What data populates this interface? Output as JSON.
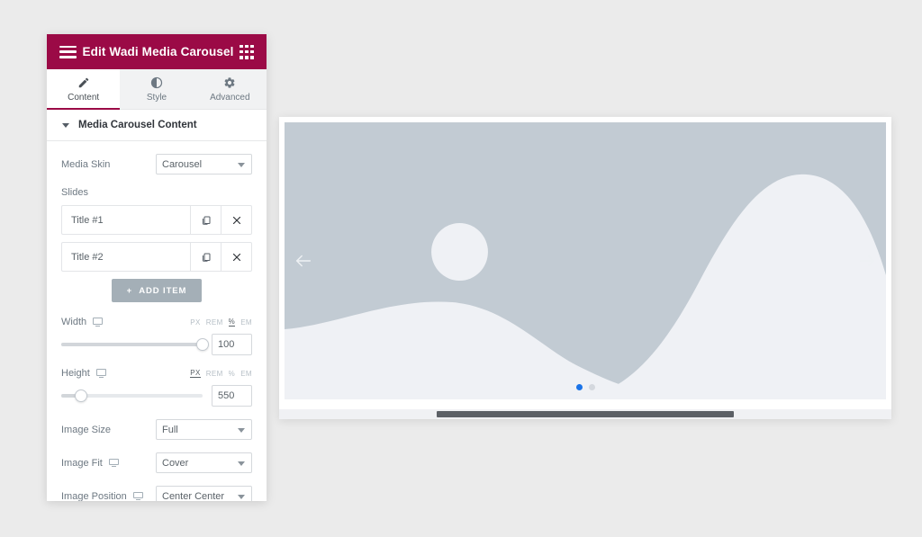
{
  "panel": {
    "header": {
      "title": "Edit Wadi Media Carousel",
      "menu_icon": "hamburger-icon",
      "apps_icon": "apps-grid-icon",
      "background_color": "#9b0a46"
    },
    "tabs": [
      {
        "label": "Content",
        "icon": "pencil-icon",
        "active": true
      },
      {
        "label": "Style",
        "icon": "contrast-icon",
        "active": false
      },
      {
        "label": "Advanced",
        "icon": "gear-icon",
        "active": false
      }
    ],
    "section": {
      "title": "Media Carousel Content",
      "collapsed": false
    },
    "controls": {
      "media_skin": {
        "label": "Media Skin",
        "value": "Carousel"
      },
      "slides": {
        "label": "Slides",
        "items": [
          {
            "title": "Title #1"
          },
          {
            "title": "Title #2"
          }
        ],
        "add_button": "ADD ITEM"
      },
      "width": {
        "label": "Width",
        "value": "100",
        "units": [
          "PX",
          "REM",
          "%",
          "EM"
        ],
        "active_unit": "%",
        "slider_percent": 100,
        "responsive_icon": "desktop-icon"
      },
      "height": {
        "label": "Height",
        "value": "550",
        "units": [
          "PX",
          "REM",
          "%",
          "EM"
        ],
        "active_unit": "PX",
        "slider_percent": 14,
        "responsive_icon": "desktop-icon"
      },
      "image_size": {
        "label": "Image Size",
        "value": "Full"
      },
      "image_fit": {
        "label": "Image Fit",
        "value": "Cover",
        "responsive_icon": "desktop-icon"
      },
      "image_position": {
        "label": "Image Position",
        "value": "Center Center",
        "responsive_icon": "desktop-icon"
      }
    }
  },
  "preview": {
    "slide": {
      "placeholder_name": "image-placeholder",
      "background_color": "#c2cbd3",
      "shape_color": "#eff1f5"
    },
    "prev_arrow": "arrow-left-icon",
    "next_arrow": "arrow-right-icon",
    "pagination": [
      {
        "active": true
      },
      {
        "active": false
      }
    ],
    "active_dot_color": "#1a73e8"
  }
}
